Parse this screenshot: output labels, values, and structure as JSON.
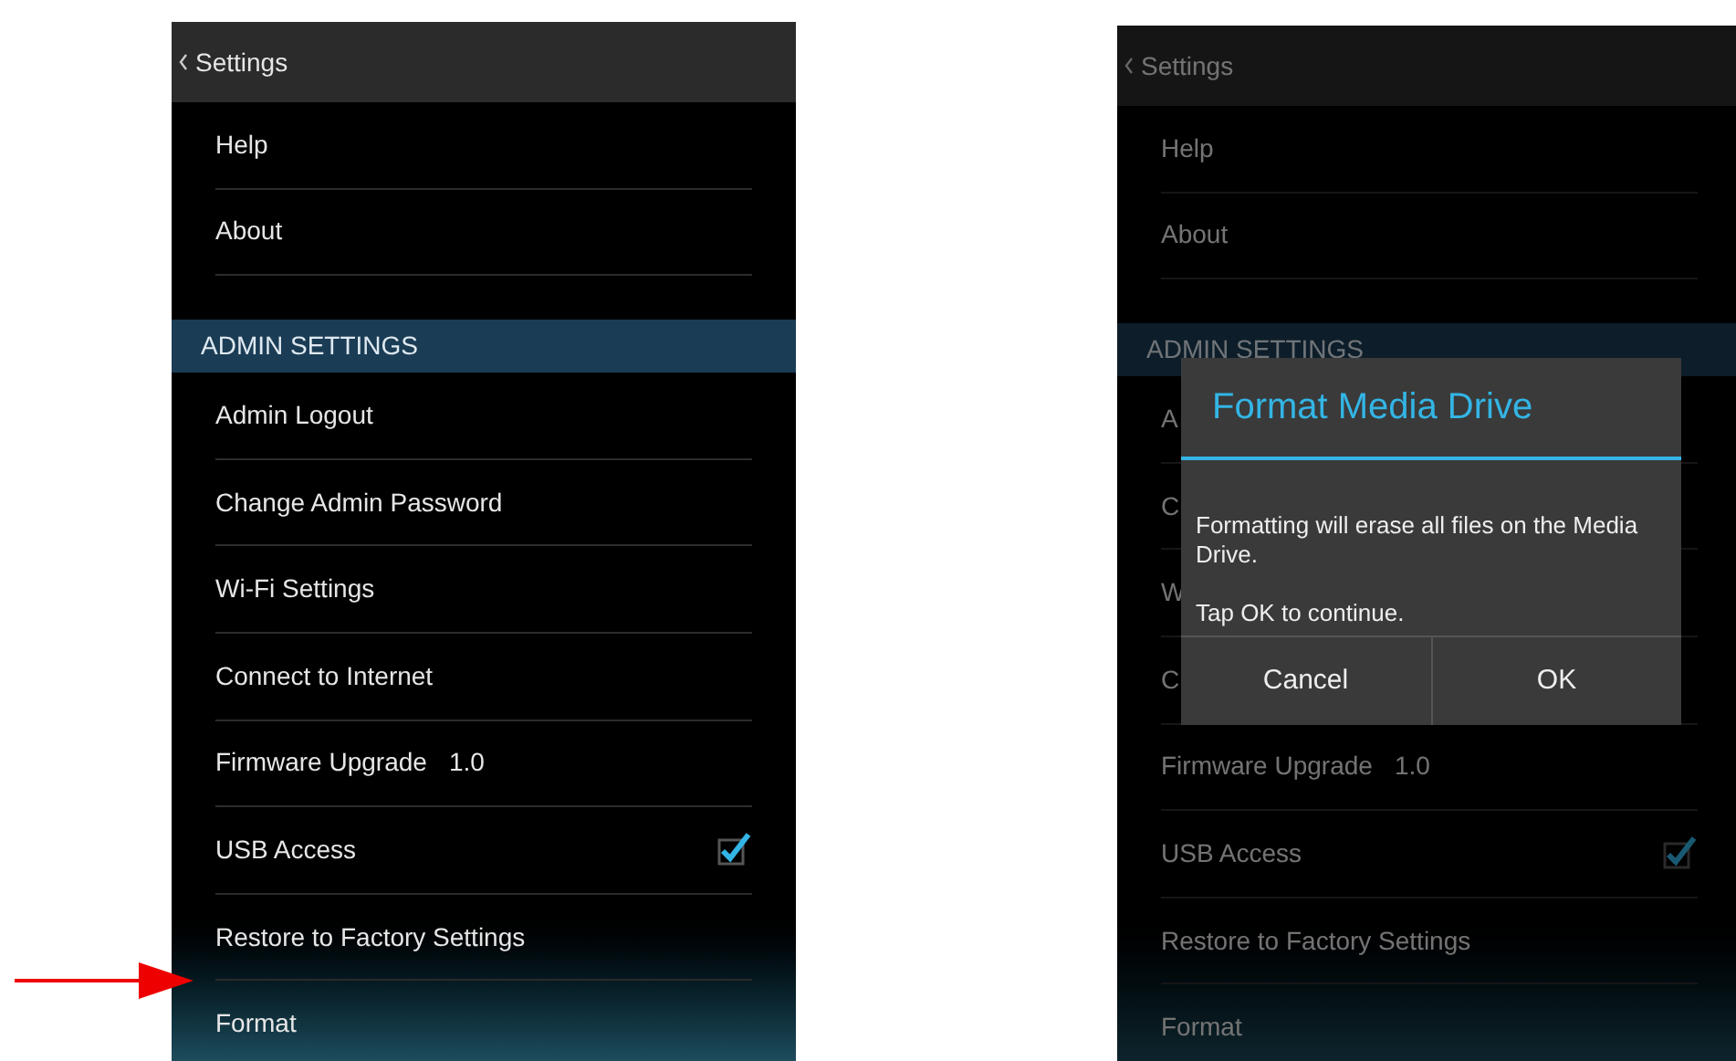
{
  "screens": [
    {
      "title": "Settings",
      "dimmed": false,
      "items": [
        {
          "kind": "item",
          "label": "Help"
        },
        {
          "kind": "item",
          "label": "About"
        },
        {
          "kind": "header",
          "label": "ADMIN SETTINGS"
        },
        {
          "kind": "item",
          "label": "Admin Logout"
        },
        {
          "kind": "item",
          "label": "Change Admin Password"
        },
        {
          "kind": "item",
          "label": "Wi-Fi Settings"
        },
        {
          "kind": "item",
          "label": "Connect to Internet"
        },
        {
          "kind": "item",
          "label": "Firmware Upgrade",
          "value": "1.0"
        },
        {
          "kind": "checkbox",
          "label": "USB Access",
          "checked": true
        },
        {
          "kind": "item",
          "label": "Restore to Factory Settings"
        },
        {
          "kind": "item",
          "label": "Format"
        }
      ],
      "arrow": true
    },
    {
      "title": "Settings",
      "dimmed": true,
      "items": [
        {
          "kind": "item",
          "label": "Help"
        },
        {
          "kind": "item",
          "label": "About"
        },
        {
          "kind": "header",
          "label": "ADMIN SETTINGS"
        },
        {
          "kind": "item",
          "label": "A"
        },
        {
          "kind": "item",
          "label": "C"
        },
        {
          "kind": "item",
          "label": "W"
        },
        {
          "kind": "item",
          "label": "C"
        },
        {
          "kind": "item",
          "label": "Firmware Upgrade",
          "value": "1.0"
        },
        {
          "kind": "checkbox",
          "label": "USB Access",
          "checked": true
        },
        {
          "kind": "item",
          "label": "Restore to Factory Settings"
        },
        {
          "kind": "item",
          "label": "Format"
        }
      ],
      "arrow": false,
      "dialog": {
        "title": "Format Media Drive",
        "message": "Formatting will erase all files on the Media Drive.",
        "note": "Tap OK to continue.",
        "buttons": [
          "Cancel",
          "OK"
        ]
      }
    }
  ]
}
